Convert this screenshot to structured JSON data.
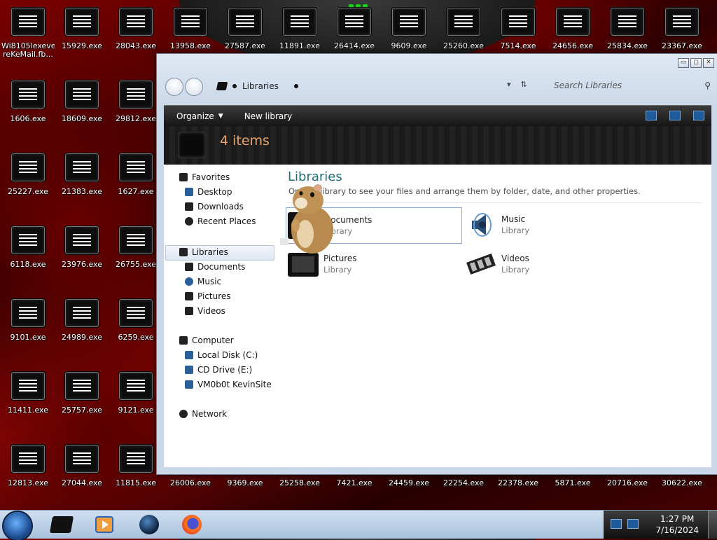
{
  "desktop": {
    "icons": [
      {
        "label": "Wi8105lexeve\nreKeMail.fb...",
        "x": 1,
        "y": 2
      },
      {
        "label": "15929.exe"
      },
      {
        "label": "28043.exe"
      },
      {
        "label": "13958.exe"
      },
      {
        "label": "27587.exe"
      },
      {
        "label": "11891.exe"
      },
      {
        "label": "26414.exe"
      },
      {
        "label": "9609.exe"
      },
      {
        "label": "25260.exe"
      },
      {
        "label": "7514.exe"
      },
      {
        "label": "24656.exe"
      },
      {
        "label": "25834.exe"
      },
      {
        "label": "23367.exe"
      },
      {
        "label": "1606.exe"
      },
      {
        "label": "18609.exe"
      },
      {
        "label": "29812.exe"
      },
      {
        "label": "25227.exe"
      },
      {
        "label": "21383.exe"
      },
      {
        "label": "1627.exe"
      },
      {
        "label": "6118.exe"
      },
      {
        "label": "23976.exe"
      },
      {
        "label": "26755.exe"
      },
      {
        "label": "9101.exe"
      },
      {
        "label": "24989.exe"
      },
      {
        "label": "6259.exe"
      },
      {
        "label": "11411.exe"
      },
      {
        "label": "25757.exe"
      },
      {
        "label": "9121.exe"
      },
      {
        "label": "12813.exe"
      },
      {
        "label": "27044.exe"
      },
      {
        "label": "11815.exe"
      },
      {
        "label": "26006.exe"
      },
      {
        "label": "9369.exe"
      },
      {
        "label": "25258.exe"
      },
      {
        "label": "7421.exe"
      },
      {
        "label": "24459.exe"
      },
      {
        "label": "22254.exe"
      },
      {
        "label": "22378.exe"
      },
      {
        "label": "5871.exe"
      },
      {
        "label": "20716.exe"
      },
      {
        "label": "30622.exe"
      }
    ]
  },
  "window": {
    "address": "Libraries",
    "search_placeholder": "Search Libraries",
    "toolbar": {
      "organize": "Organize",
      "new_library": "New library"
    },
    "header_count": "4 items",
    "nav": {
      "favorites": "Favorites",
      "desktop": "Desktop",
      "downloads": "Downloads",
      "recent_places": "Recent Places",
      "libraries": "Libraries",
      "documents": "Documents",
      "music": "Music",
      "pictures": "Pictures",
      "videos": "Videos",
      "computer": "Computer",
      "local_disk": "Local Disk (C:)",
      "cd_drive": "CD Drive (E:)",
      "network_share": "VM0b0t KevinSite",
      "network": "Network"
    },
    "content": {
      "title": "Libraries",
      "subtitle": "Open a library to see your files and arrange them by folder, date, and other properties.",
      "items": [
        {
          "name": "Documents",
          "kind": "Library"
        },
        {
          "name": "Music",
          "kind": "Library"
        },
        {
          "name": "Pictures",
          "kind": "Library"
        },
        {
          "name": "Videos",
          "kind": "Library"
        }
      ]
    },
    "title_buttons": {
      "minimize": "▭",
      "maximize": "◻",
      "close": "✕"
    }
  },
  "taskbar": {
    "items": [
      "explorer",
      "media-player",
      "globe",
      "firefox"
    ],
    "clock_time": "1:27 PM",
    "clock_date": "7/16/2024"
  },
  "icons": {
    "desktop_icon": "exe-file-icon",
    "start": "windows-start-orb-icon"
  }
}
